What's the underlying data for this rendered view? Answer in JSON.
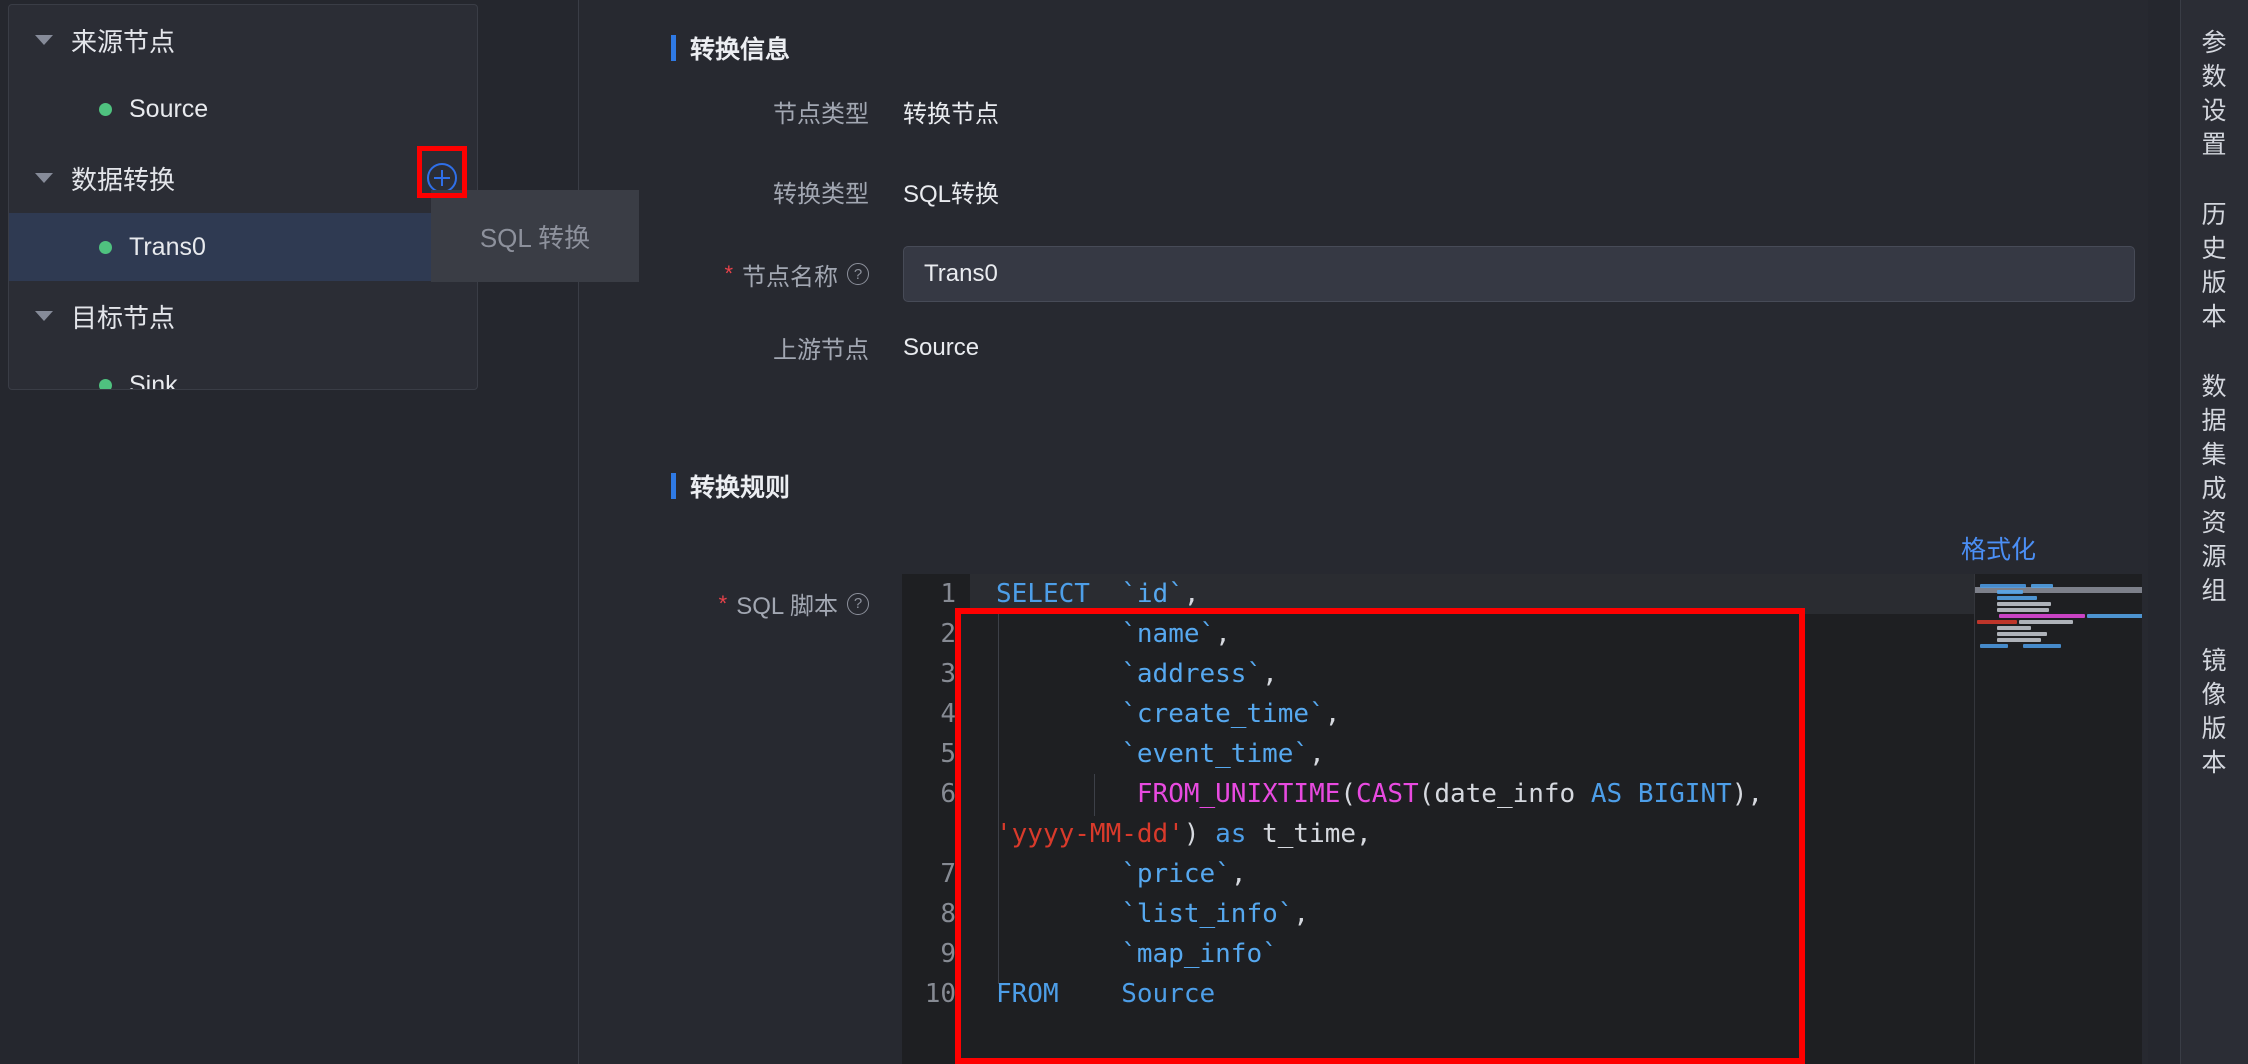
{
  "left_tree": {
    "groups": [
      {
        "label": "来源节点",
        "has_add": false,
        "items": [
          {
            "label": "Source",
            "selected": false
          }
        ]
      },
      {
        "label": "数据转换",
        "has_add": true,
        "add_icon": "plus-circle-icon",
        "items": [
          {
            "label": "Trans0",
            "selected": true
          }
        ]
      },
      {
        "label": "目标节点",
        "has_add": false,
        "items": [
          {
            "label": "Sink",
            "selected": false
          }
        ]
      }
    ]
  },
  "dropdown": {
    "visible": true,
    "options": [
      "SQL 转换"
    ]
  },
  "main": {
    "section_info_title": "转换信息",
    "section_rule_title": "转换规则",
    "fields": {
      "node_type_label": "节点类型",
      "node_type_value": "转换节点",
      "transform_type_label": "转换类型",
      "transform_type_value": "SQL转换",
      "node_name_label": "节点名称",
      "node_name_value": "Trans0",
      "node_name_required": "*",
      "upstream_label": "上游节点",
      "upstream_value": "Source",
      "sql_script_label": "SQL 脚本",
      "sql_script_required": "*",
      "help_glyph": "?"
    },
    "format_button_label": "格式化"
  },
  "editor": {
    "line_numbers": [
      "1",
      "2",
      "3",
      "4",
      "5",
      "6",
      "7",
      "8",
      "9",
      "10"
    ],
    "lines": [
      "SELECT  `id`,",
      "        `name`,",
      "        `address`,",
      "        `create_time`,",
      "        `event_time`,",
      "         FROM_UNIXTIME(CAST(date_info AS BIGINT), 'yyyy-MM-dd') as t_time,",
      "        `price`,",
      "        `list_info`,",
      "        `map_info`",
      "FROM    Source"
    ],
    "full_sql": "SELECT  `id`,\n        `name`,\n        `address`,\n        `create_time`,\n        `event_time`,\n         FROM_UNIXTIME(CAST(date_info AS BIGINT), 'yyyy-MM-dd') as t_time,\n        `price`,\n        `list_info`,\n        `map_info`\nFROM    Source"
  },
  "right_rail": {
    "items": [
      {
        "label": "参数设置"
      },
      {
        "label": "历史版本"
      },
      {
        "label": "数据集成资源组"
      },
      {
        "label": "镜像版本"
      }
    ]
  },
  "colors": {
    "accent_blue": "#2f7ae5",
    "annotation_red": "#fe0000",
    "status_green": "#4fc27f",
    "selected_row": "#2f3a52",
    "keyword": "#4d9ee8",
    "function": "#e84ae0",
    "string": "#d93a2b"
  }
}
